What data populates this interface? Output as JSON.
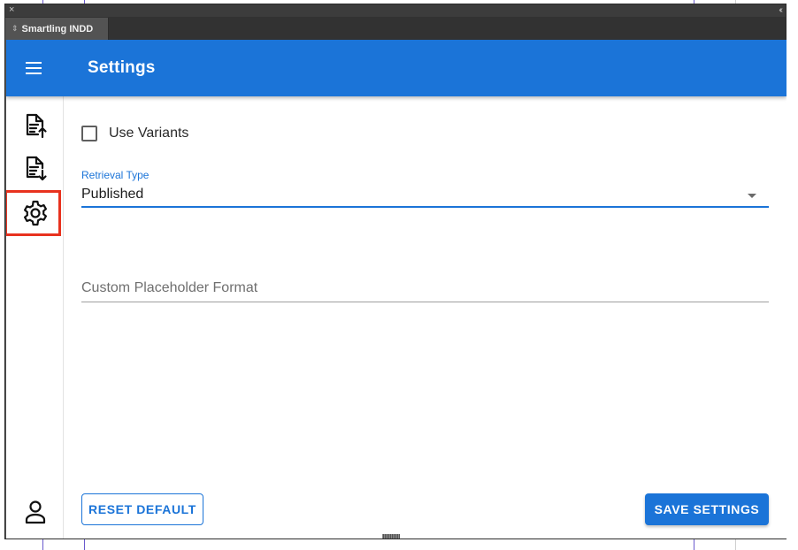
{
  "panel": {
    "close_glyph": "×",
    "collapse_glyph": "‹‹",
    "tab_grip_glyph": "⇕",
    "tab_label": "Smartling INDD"
  },
  "appbar": {
    "title": "Settings",
    "menu_icon": "menu-icon",
    "color": "#1b74d8"
  },
  "sidebar": {
    "items": [
      {
        "name": "upload-file-icon",
        "selected": false
      },
      {
        "name": "download-file-icon",
        "selected": false
      },
      {
        "name": "gear-icon",
        "selected": true
      },
      {
        "name": "account-icon",
        "selected": false
      }
    ],
    "selection_outline_color": "#e8321e"
  },
  "settings": {
    "use_variants": {
      "label": "Use Variants",
      "checked": false
    },
    "retrieval_type": {
      "label": "Retrieval Type",
      "value": "Published"
    },
    "custom_placeholder": {
      "placeholder": "Custom Placeholder Format",
      "value": ""
    }
  },
  "buttons": {
    "reset": "RESET DEFAULT",
    "save": "SAVE SETTINGS"
  }
}
